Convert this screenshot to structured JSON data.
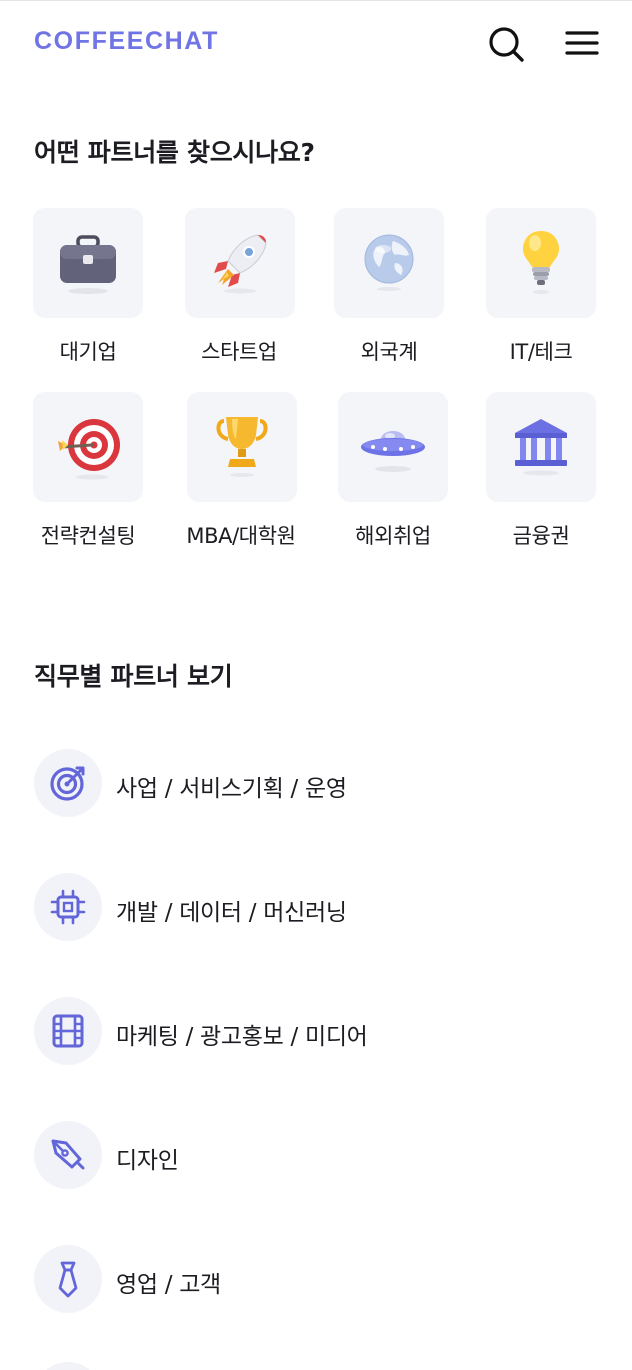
{
  "header": {
    "logo": "COFFEECHAT",
    "search_icon": "search-icon",
    "menu_icon": "hamburger-menu-icon",
    "accent_color": "#7074e4"
  },
  "partner_section": {
    "title": "어떤 파트너를 찾으시나요?",
    "categories": [
      {
        "label": "대기업",
        "icon": "briefcase-icon"
      },
      {
        "label": "스타트업",
        "icon": "rocket-icon"
      },
      {
        "label": "외국계",
        "icon": "globe-icon"
      },
      {
        "label": "IT/테크",
        "icon": "lightbulb-icon"
      },
      {
        "label": "전략컨설팅",
        "icon": "target-dart-icon"
      },
      {
        "label": "MBA/대학원",
        "icon": "trophy-icon"
      },
      {
        "label": "해외취업",
        "icon": "ufo-icon"
      },
      {
        "label": "금융권",
        "icon": "bank-icon"
      }
    ]
  },
  "job_section": {
    "title": "직무별 파트너 보기",
    "items": [
      {
        "label": "사업 / 서비스기획 / 운영",
        "icon": "target-icon"
      },
      {
        "label": "개발 / 데이터 / 머신러닝",
        "icon": "chip-icon"
      },
      {
        "label": "마케팅 / 광고홍보 / 미디어",
        "icon": "film-icon"
      },
      {
        "label": "디자인",
        "icon": "pen-tool-icon"
      },
      {
        "label": "영업 / 고객",
        "icon": "necktie-icon"
      }
    ]
  }
}
